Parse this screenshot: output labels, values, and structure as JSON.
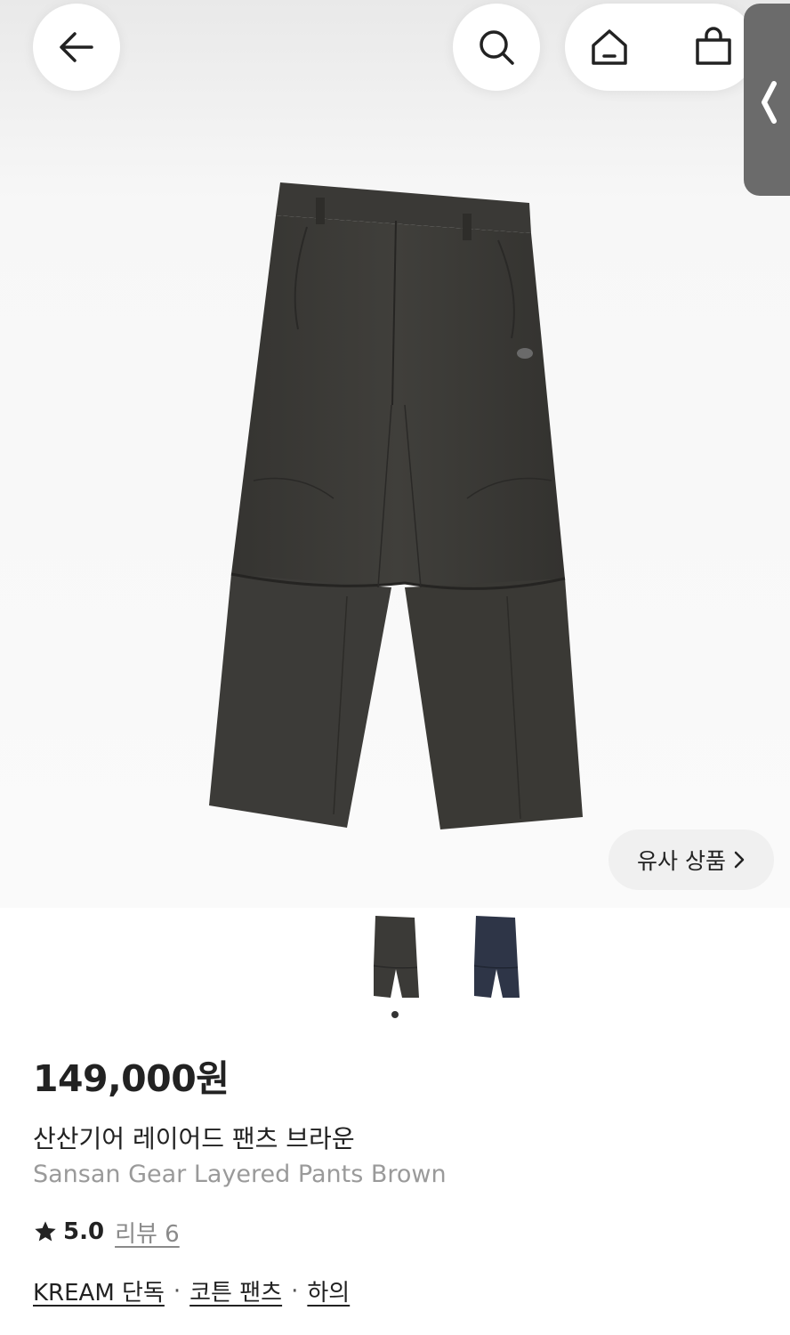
{
  "header": {
    "back_icon": "arrow-left-icon",
    "search_icon": "search-icon",
    "home_icon": "home-icon",
    "bag_icon": "shopping-bag-icon",
    "side_icon": "chevron-left-icon"
  },
  "gallery": {
    "similar_label": "유사 상품",
    "similar_icon": "chevron-right-icon",
    "thumbnails": [
      {
        "color_name": "brown",
        "color": "#3b3a37"
      },
      {
        "color_name": "navy",
        "color": "#2e3547"
      }
    ],
    "selected_index": 0
  },
  "product": {
    "price": "149,000원",
    "name_ko": "산산기어 레이어드 팬츠 브라운",
    "name_en": "Sansan Gear Layered Pants Brown",
    "rating": "5.0",
    "review_label": "리뷰 6",
    "tags": [
      "KREAM 단독",
      "코튼 팬츠",
      "하의"
    ],
    "tag_separator": "·"
  }
}
